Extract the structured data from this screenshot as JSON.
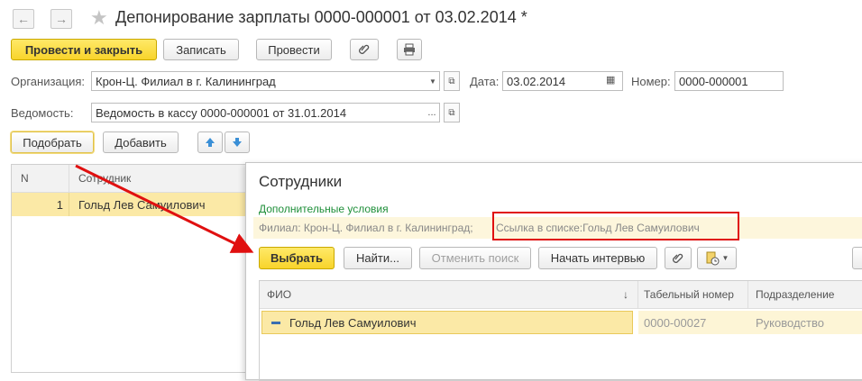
{
  "header": {
    "title": "Депонирование зарплаты 0000-000001 от 03.02.2014 *",
    "nav_back": "←",
    "nav_forward": "→",
    "star": "★"
  },
  "toolbar": {
    "post_close": "Провести и закрыть",
    "save": "Записать",
    "post": "Провести",
    "attach_icon": "paperclip-icon",
    "print_icon": "printer-icon"
  },
  "form": {
    "org_label": "Организация:",
    "org_value": "Крон-Ц. Филиал в г. Калининград",
    "date_label": "Дата:",
    "date_value": "03.02.2014",
    "number_label": "Номер:",
    "number_value": "0000-000001",
    "statement_label": "Ведомость:",
    "statement_value": "Ведомость в кассу 0000-000001 от 31.01.2014"
  },
  "table_toolbar": {
    "pick": "Подобрать",
    "add": "Добавить"
  },
  "main_table": {
    "columns": [
      "N",
      "Сотрудник"
    ],
    "rows": [
      {
        "n": "1",
        "employee": "Гольд Лев Самуилович"
      }
    ]
  },
  "dialog": {
    "title": "Сотрудники",
    "conditions_label": "Дополнительные условия",
    "filter_text": "Филиал: Крон-Ц. Филиал в г. Калининград;",
    "filter_highlight": "Ссылка в списке:Гольд Лев Самуилович",
    "buttons": {
      "select": "Выбрать",
      "find": "Найти...",
      "cancel_search": "Отменить поиск",
      "interview": "Начать интервью"
    },
    "columns": [
      "ФИО",
      "Табельный номер",
      "Подразделение"
    ],
    "sort_arrow": "↓",
    "rows": [
      {
        "name": "Гольд Лев Самуилович",
        "tab_number": "0000-00027",
        "department": "Руководство"
      }
    ]
  },
  "colors": {
    "accent_yellow": "#f8d42b",
    "row_highlight": "#fbe9a6",
    "green_link": "#1f8f3a",
    "annotation_red": "#e01010"
  }
}
